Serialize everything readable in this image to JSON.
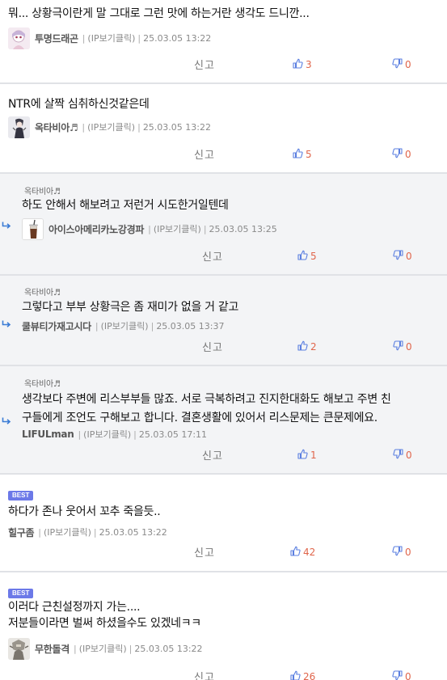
{
  "labels": {
    "report": "신고"
  },
  "colors": {
    "best_badge": "#6c79e8",
    "vote_count": "#e0654b",
    "thumb_icon": "#5b7fe0",
    "reply_bg": "#f3f4f6"
  },
  "comments": [
    {
      "type": "top",
      "best": false,
      "lines": [
        "뭐... 상황극이란게 말 그대로 그런 맛에 하는거란 생각도 드니깐..."
      ],
      "nick": "투명드래곤",
      "avatar": "anime-girl-avatar",
      "ip": "(IP보기클릭)",
      "date": "25.03.05 13:22",
      "up": "3",
      "down": "0"
    },
    {
      "type": "top",
      "best": false,
      "lines": [
        "NTR에 살짝 심취하신것같은데"
      ],
      "nick": "옥타비아♬",
      "avatar": "character-avatar",
      "ip": "(IP보기클릭)",
      "date": "25.03.05 13:22",
      "up": "5",
      "down": "0"
    },
    {
      "type": "reply",
      "best": false,
      "mention": "옥타비아♬",
      "lines": [
        "하도 안해서 해보려고 저런거 시도한거일텐데"
      ],
      "nick": "아이스아메리카노강경파",
      "avatar": "iced-coffee-avatar",
      "ip": "(IP보기클릭)",
      "date": "25.03.05 13:25",
      "up": "5",
      "down": "0"
    },
    {
      "type": "reply",
      "best": false,
      "mention": "옥타비아♬",
      "lines": [
        "그렇다고 부부 상황극은 좀 재미가 없을 거 같고"
      ],
      "nick": "쿨뷰티가재고시다",
      "avatar": "",
      "ip": "(IP보기클릭)",
      "date": "25.03.05 13:37",
      "up": "2",
      "down": "0"
    },
    {
      "type": "reply",
      "best": false,
      "mention": "옥타비아♬",
      "lines": [
        "생각보다 주변에 리스부부들 많죠. 서로 극복하려고 진지한대화도 해보고 주변 친",
        "구들에게 조언도 구해보고 합니다. 결혼생활에 있어서 리스문제는 큰문제에요."
      ],
      "nick": "LIFULman",
      "avatar": "",
      "ip": "(IP보기클릭)",
      "date": "25.03.05 17:11",
      "up": "1",
      "down": "0"
    },
    {
      "type": "top",
      "best": true,
      "best_label": "BEST",
      "lines": [
        "하다가 존나 웃어서 꼬추 죽을듯.."
      ],
      "nick": "힐구좀",
      "avatar": "",
      "ip": "(IP보기클릭)",
      "date": "25.03.05 13:22",
      "up": "42",
      "down": "0"
    },
    {
      "type": "top",
      "best": true,
      "best_label": "BEST",
      "lines": [
        "이러다 근친설정까지 가는....",
        "저분들이라면 벌써 하셨을수도 있겠네ㅋㅋ"
      ],
      "nick": "무한돌격",
      "avatar": "robot-avatar",
      "ip": "(IP보기클릭)",
      "date": "25.03.05 13:22",
      "up": "26",
      "down": "0"
    }
  ]
}
